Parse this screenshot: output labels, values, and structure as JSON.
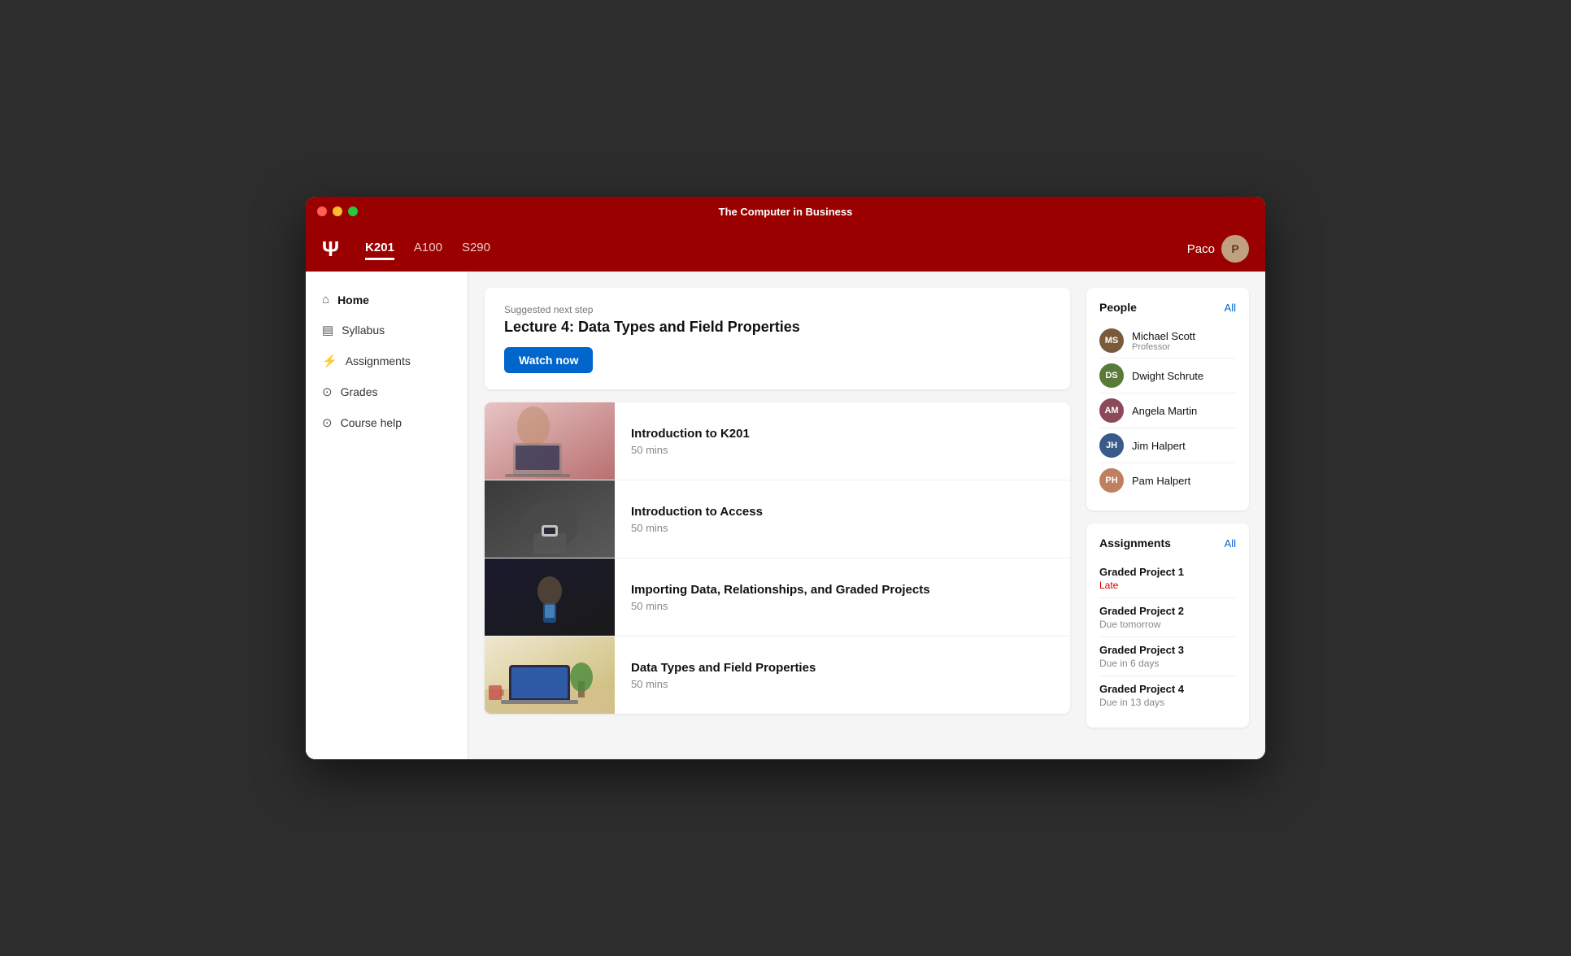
{
  "window": {
    "title": "The Computer in Business"
  },
  "navbar": {
    "logo": "Ψ",
    "tabs": [
      {
        "id": "k201",
        "label": "K201",
        "active": true
      },
      {
        "id": "a100",
        "label": "A100",
        "active": false
      },
      {
        "id": "s290",
        "label": "S290",
        "active": false
      }
    ],
    "user_name": "Paco"
  },
  "sidebar": {
    "items": [
      {
        "id": "home",
        "label": "Home",
        "icon": "⌂",
        "active": true
      },
      {
        "id": "syllabus",
        "label": "Syllabus",
        "icon": "☰",
        "active": false
      },
      {
        "id": "assignments",
        "label": "Assignments",
        "icon": "≈",
        "active": false
      },
      {
        "id": "grades",
        "label": "Grades",
        "icon": "◎",
        "active": false
      },
      {
        "id": "course-help",
        "label": "Course help",
        "icon": "◎",
        "active": false
      }
    ]
  },
  "suggested": {
    "label": "Suggested next step",
    "title": "Lecture 4: Data Types and Field Properties",
    "button": "Watch now"
  },
  "courses": [
    {
      "id": 1,
      "name": "Introduction to K201",
      "duration": "50 mins",
      "thumb": "thumb-1"
    },
    {
      "id": 2,
      "name": "Introduction to Access",
      "duration": "50 mins",
      "thumb": "thumb-2"
    },
    {
      "id": 3,
      "name": "Importing Data, Relationships, and Graded Projects",
      "duration": "50 mins",
      "thumb": "thumb-3"
    },
    {
      "id": 4,
      "name": "Data Types and Field Properties",
      "duration": "50 mins",
      "thumb": "thumb-4"
    },
    {
      "id": 5,
      "name": "",
      "duration": "",
      "thumb": "thumb-5"
    }
  ],
  "people": {
    "title": "People",
    "all_link": "All",
    "items": [
      {
        "name": "Michael Scott",
        "role": "Professor",
        "color": "#7a5a3a"
      },
      {
        "name": "Dwight Schrute",
        "role": "",
        "color": "#5a7a3a"
      },
      {
        "name": "Angela Martin",
        "role": "",
        "color": "#8a4a5a"
      },
      {
        "name": "Jim Halpert",
        "role": "",
        "color": "#3a5a8a"
      },
      {
        "name": "Pam Halpert",
        "role": "",
        "color": "#c08060"
      }
    ]
  },
  "assignments": {
    "title": "Assignments",
    "all_link": "All",
    "items": [
      {
        "name": "Graded Project 1",
        "status": "Late",
        "status_type": "late"
      },
      {
        "name": "Graded Project 2",
        "status": "Due tomorrow",
        "status_type": "due"
      },
      {
        "name": "Graded Project 3",
        "status": "Due in 6 days",
        "status_type": "due"
      },
      {
        "name": "Graded Project 4",
        "status": "Due in 13 days",
        "status_type": "due"
      }
    ]
  }
}
